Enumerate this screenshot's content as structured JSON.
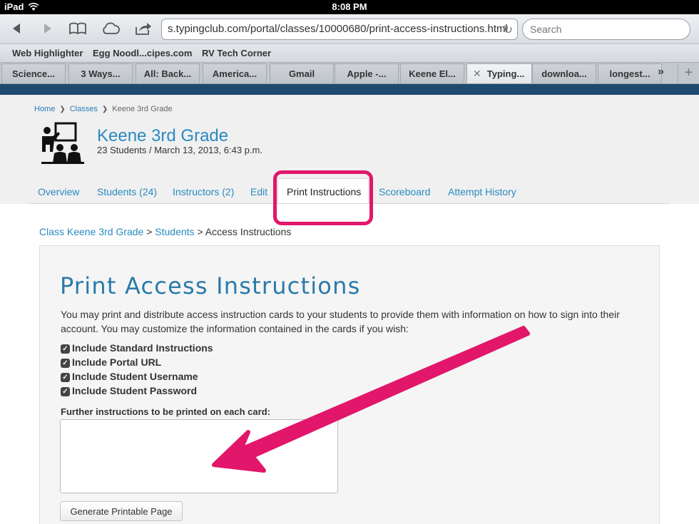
{
  "status_bar": {
    "device": "iPad",
    "time": "8:08 PM"
  },
  "browser": {
    "url": "s.typingclub.com/portal/classes/10000680/print-access-instructions.html",
    "search_placeholder": "Search",
    "bookmarks": [
      "Web Highlighter",
      "Egg Noodl...cipes.com",
      "RV Tech Corner"
    ],
    "tabs": [
      {
        "label": "Science..."
      },
      {
        "label": "3 Ways..."
      },
      {
        "label": "All: Back..."
      },
      {
        "label": "America..."
      },
      {
        "label": "Gmail"
      },
      {
        "label": "Apple -..."
      },
      {
        "label": "Keene El..."
      },
      {
        "label": "Typing...",
        "active": true
      },
      {
        "label": "downloa..."
      },
      {
        "label": "longest..."
      }
    ],
    "more_tabs": "»",
    "new_tab": "+"
  },
  "breadcrumb": {
    "home": "Home",
    "classes": "Classes",
    "current": "Keene 3rd Grade"
  },
  "class_info": {
    "title": "Keene 3rd Grade",
    "subtitle": "23 Students / March 13, 2013, 6:43 p.m."
  },
  "nav_tabs": [
    "Overview",
    "Students (24)",
    "Instructors (2)",
    "Edit",
    "Print Instructions",
    "Scoreboard",
    "Attempt History"
  ],
  "sub_breadcrumb": {
    "class_link": "Class Keene 3rd Grade",
    "separator": ">",
    "students_link": "Students",
    "current": "Access Instructions"
  },
  "main": {
    "title": "Print Access Instructions",
    "description": "You may print and distribute access instruction cards to your students to provide them with information on how to sign into their account. You may customize the information contained in the cards if you wish:",
    "checkboxes": [
      "Include Standard Instructions",
      "Include Portal URL",
      "Include Student Username",
      "Include Student Password"
    ],
    "further_label": "Further instructions to be printed on each card:",
    "further_value": "",
    "generate_button": "Generate Printable Page"
  },
  "colors": {
    "accent": "#2a8ac0",
    "highlight": "#e2166a"
  }
}
